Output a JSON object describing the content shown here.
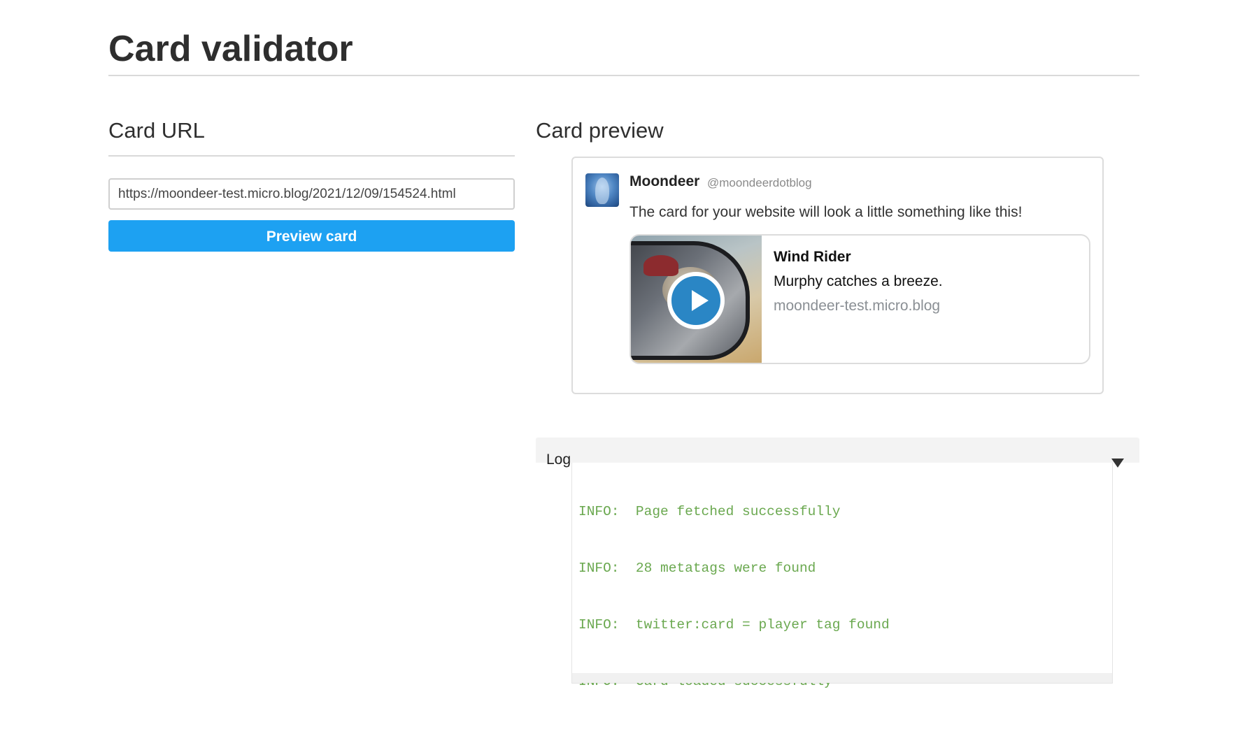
{
  "page": {
    "title": "Card validator"
  },
  "url_section": {
    "heading": "Card URL",
    "input_value": "https://moondeer-test.micro.blog/2021/12/09/154524.html",
    "button_label": "Preview card",
    "button_color": "#1da1f2"
  },
  "preview_section": {
    "heading": "Card preview",
    "tweet": {
      "name": "Moondeer",
      "handle": "@moondeerdotblog",
      "text": "The card for your website will look a little something like this!",
      "avatar_icon": "user-avatar-image"
    },
    "card": {
      "thumbnail_icon": "play-icon",
      "title": "Wind Rider",
      "description": "Murphy catches a breeze.",
      "domain": "moondeer-test.micro.blog"
    }
  },
  "log": {
    "label": "Log",
    "toggle_icon": "triangle-down-icon",
    "text_color": "#6aa84f",
    "lines": [
      "INFO:  Page fetched successfully",
      "INFO:  28 metatags were found",
      "INFO:  twitter:card = player tag found",
      "INFO:  Card loaded successfully"
    ]
  }
}
